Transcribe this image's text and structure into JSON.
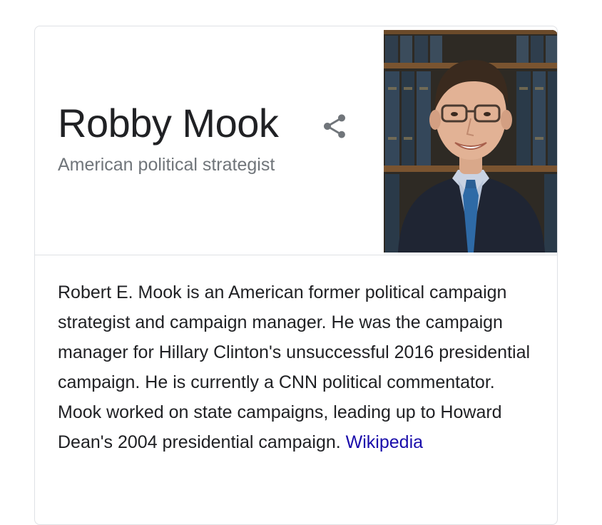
{
  "entity": {
    "name": "Robby Mook",
    "subtitle": "American political strategist"
  },
  "description": {
    "text": "Robert E. Mook is an American former political campaign strategist and campaign manager. He was the campaign manager for Hillary Clinton's unsuccessful 2016 presidential campaign. He is currently a CNN political commentator. Mook worked on state campaigns, leading up to Howard Dean's 2004 presidential campaign.",
    "source_link": "Wikipedia"
  },
  "icons": {
    "share": "share-icon"
  },
  "colors": {
    "title": "#202124",
    "subtitle": "#70757a",
    "link": "#1a0dab",
    "border": "#dfe1e5",
    "icon": "#70757a"
  }
}
